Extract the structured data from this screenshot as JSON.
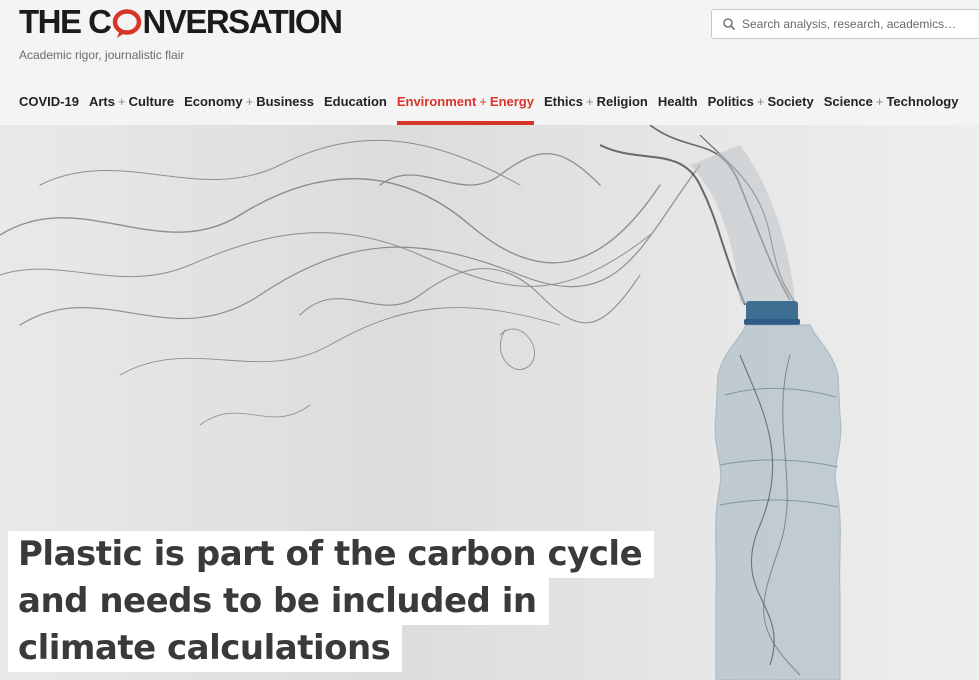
{
  "brand": {
    "name_before": "THE C",
    "name_after": "NVERSATION",
    "tagline": "Academic rigor, journalistic flair",
    "accent_color": "#d8352a"
  },
  "search": {
    "placeholder": "Search analysis, research, academics…",
    "icon": "search-icon"
  },
  "nav": {
    "items": [
      {
        "label": "COVID-19"
      },
      {
        "a": "Arts",
        "b": "Culture"
      },
      {
        "a": "Economy",
        "b": "Business"
      },
      {
        "label": "Education"
      },
      {
        "a": "Environment",
        "b": "Energy",
        "active": true
      },
      {
        "a": "Ethics",
        "b": "Religion"
      },
      {
        "label": "Health"
      },
      {
        "a": "Politics",
        "b": "Society"
      },
      {
        "a": "Science",
        "b": "Technology"
      }
    ],
    "plus": "+"
  },
  "article": {
    "headline_lines": [
      "Plastic is part of the carbon cycle",
      "and needs to be included in",
      "climate calculations"
    ]
  }
}
